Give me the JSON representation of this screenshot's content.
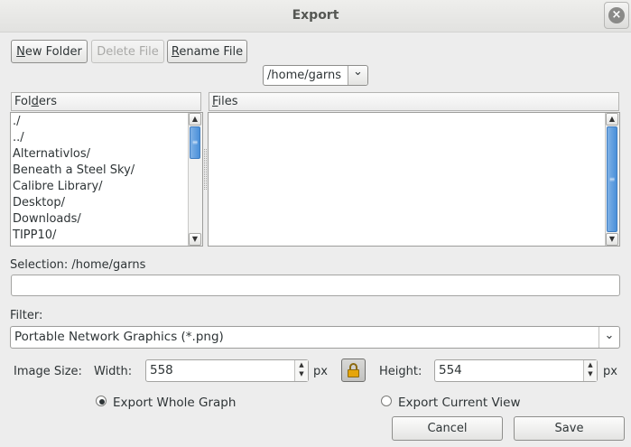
{
  "window": {
    "title": "Export",
    "close_glyph": "×"
  },
  "toolbar": {
    "new_folder_prefix": "N",
    "new_folder_rest": "ew Folder",
    "delete_file": "Delete File",
    "rename_file_prefix": "R",
    "rename_file_rest": "ename File"
  },
  "path": {
    "current": "/home/garns",
    "dropdown_glyph": "⌄"
  },
  "folders": {
    "header_pre": "Fol",
    "header_u": "d",
    "header_post": "ers",
    "items": [
      "./",
      "../",
      "Alternativlos/",
      "Beneath a Steel Sky/",
      "Calibre Library/",
      "Desktop/",
      "Downloads/",
      "TIPP10/"
    ]
  },
  "files": {
    "header_u": "F",
    "header_post": "iles",
    "items": []
  },
  "selection": {
    "label": "Selection: /home/garns",
    "value": ""
  },
  "filter": {
    "label": "Filter:",
    "selected": "Portable Network Graphics (*.png)"
  },
  "image_size": {
    "label": "Image Size:",
    "width_label": "Width:",
    "width_value": "558",
    "width_unit": "px",
    "height_label": "Height:",
    "height_value": "554",
    "height_unit": "px"
  },
  "export_mode": {
    "whole_graph": "Export Whole Graph",
    "current_view": "Export Current View",
    "selected": "whole_graph"
  },
  "actions": {
    "cancel": "Cancel",
    "save": "Save"
  },
  "colors": {
    "accent": "#4a90d9",
    "lock": "#e5a50a"
  }
}
